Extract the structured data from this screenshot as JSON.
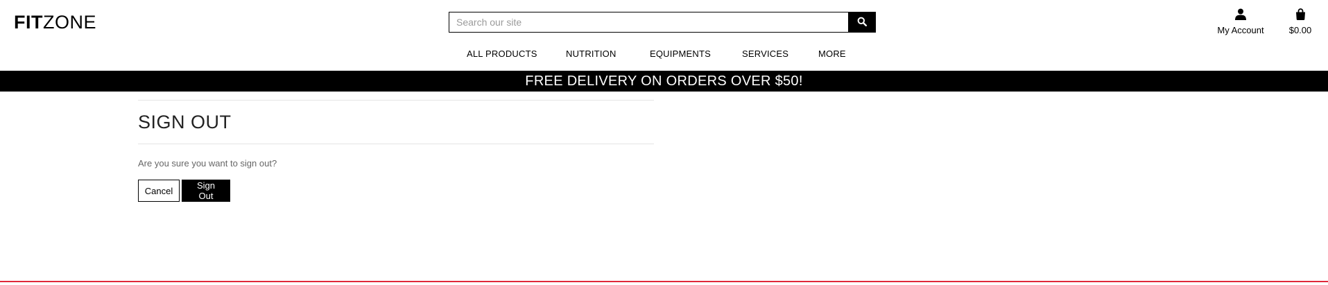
{
  "brand": {
    "logo_bold": "FIT",
    "logo_light": "ZONE"
  },
  "search": {
    "placeholder": "Search our site",
    "value": "",
    "icon": "search-icon"
  },
  "header": {
    "account_label": "My Account",
    "account_icon": "user-icon",
    "cart_total": "$0.00",
    "cart_icon": "shopping-bag-icon"
  },
  "nav": {
    "items": [
      {
        "label": "ALL PRODUCTS"
      },
      {
        "label": "NUTRITION"
      },
      {
        "label": "EQUIPMENTS"
      },
      {
        "label": "SERVICES"
      },
      {
        "label": "MORE"
      }
    ]
  },
  "banner": {
    "text": "FREE DELIVERY ON ORDERS OVER $50!"
  },
  "main": {
    "title": "SIGN OUT",
    "message": "Are you sure you want to sign out?",
    "cancel_label": "Cancel",
    "signout_label": "Sign Out"
  },
  "colors": {
    "banner_bg": "#000000",
    "footer_accent": "#e0283a",
    "muted_text": "#666666"
  }
}
